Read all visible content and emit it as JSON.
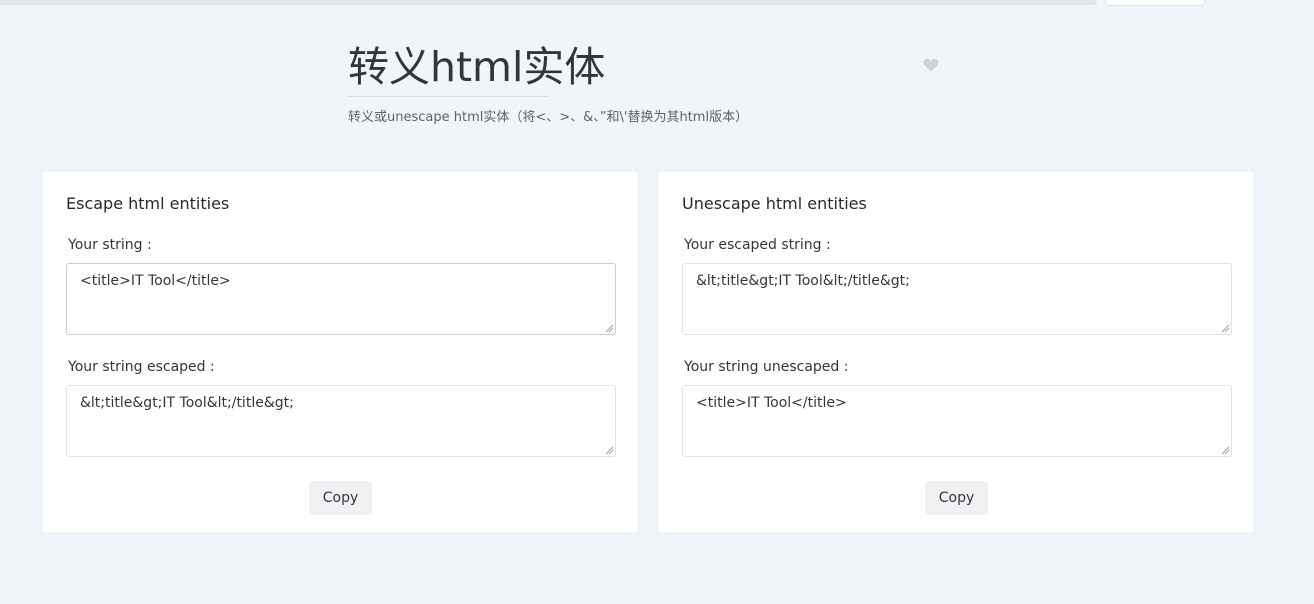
{
  "header": {
    "title": "转义html实体",
    "description": "转义或unescape html实体（将<、>、&、”和\\'替换为其html版本）",
    "favorite_icon": "heart-icon"
  },
  "escape_card": {
    "title": "Escape html entities",
    "input_label": "Your string :",
    "input_value": "<title>IT Tool</title>",
    "output_label": "Your string escaped :",
    "output_value": "&lt;title&gt;IT Tool&lt;/title&gt;",
    "copy_label": "Copy"
  },
  "unescape_card": {
    "title": "Unescape html entities",
    "input_label": "Your escaped string :",
    "input_value": "&lt;title&gt;IT Tool&lt;/title&gt;",
    "output_label": "Your string unescaped :",
    "output_value": "<title>IT Tool</title>",
    "copy_label": "Copy"
  },
  "colors": {
    "background": "#f1f4f8",
    "card": "#ffffff",
    "text": "#333639",
    "button": "#f0f1f3"
  }
}
